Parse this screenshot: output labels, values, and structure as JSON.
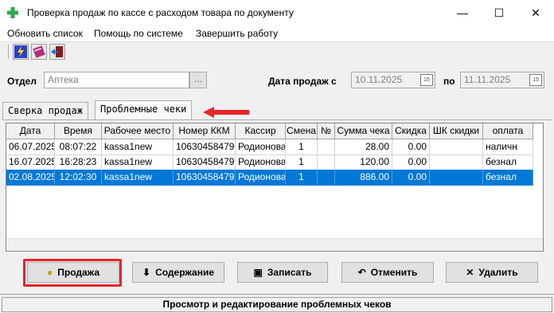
{
  "window": {
    "title": "Проверка продаж по кассе с расходом товара по документу",
    "minimize_glyph": "—",
    "maximize_glyph": "☐",
    "close_glyph": "✕"
  },
  "menu": [
    "Обновить список",
    "Помощь по системе",
    "Завершить работу"
  ],
  "toolbar": {
    "icons": [
      "lightning-icon",
      "book-icon",
      "exit-door-icon"
    ]
  },
  "filters": {
    "dept_label": "Отдел",
    "dept_value": "Аптека",
    "dept_browse": "...",
    "date_label": "Дата продаж с",
    "date_from": "10.11.2025",
    "date_to_label": "по",
    "date_to": "11.11.2025",
    "cal_glyph": "15"
  },
  "tabs": [
    "Сверка продаж",
    "Проблемные чеки"
  ],
  "active_tab": "Проблемные чеки",
  "grid": {
    "columns": [
      "Дата",
      "Время",
      "Рабочее место",
      "Номер ККМ",
      "Кассир",
      "Смена",
      "№",
      "Сумма чека",
      "Скидка",
      "ШК скидки",
      "оплата"
    ],
    "rows": [
      [
        "06.07.2025",
        "08:07:22",
        "kassa1new",
        "10630458479",
        "Родионова",
        "1",
        "",
        "28.00",
        "0.00",
        "",
        "наличн"
      ],
      [
        "16.07.2025",
        "16:28:23",
        "kassa1new",
        "10630458479",
        "Родионова",
        "1",
        "",
        "120.00",
        "0.00",
        "",
        "безнал"
      ],
      [
        "02.08.2025",
        "12:02:30",
        "kassa1new",
        "10630458479",
        "Родионова",
        "1",
        "",
        "886.00",
        "0.00",
        "",
        "безнал"
      ]
    ],
    "selected_row": 2
  },
  "buttons": {
    "sale": "Продажа",
    "contents": "Содержание",
    "save": "Записать",
    "cancel": "Отменить",
    "delete": "Удалить"
  },
  "status": "Просмотр и редактирование проблемных чеков",
  "colors": {
    "selection": "#0078d7",
    "highlight": "#e8232a",
    "app_icon": "#2fa84f"
  }
}
